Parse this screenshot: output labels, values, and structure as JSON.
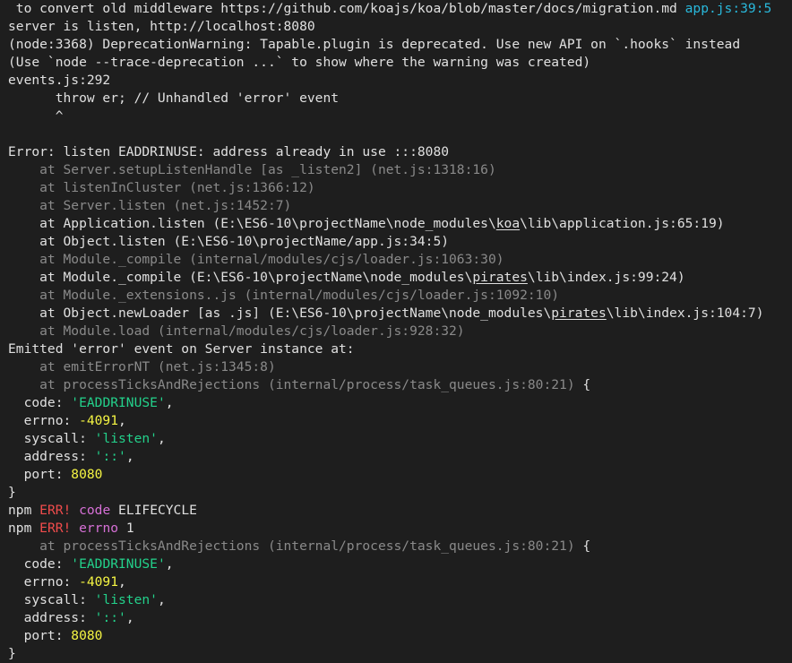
{
  "colors": {
    "background": "#1e1e1e",
    "default": "#e0e0e0",
    "gray": "#8a8a8a",
    "green": "#23d18b",
    "yellow": "#f5f543",
    "red": "#f14c4c",
    "magenta": "#d670d6",
    "cyan": "#29b8db"
  },
  "lines": [
    [
      {
        "t": " to convert old middleware https://github.com/koajs/koa/blob/master/docs/migration.md ",
        "c": "default"
      },
      {
        "t": "app.js:39:5",
        "c": "cyan"
      }
    ],
    [
      {
        "t": "server is listen, http://localhost:8080",
        "c": "default"
      }
    ],
    [
      {
        "t": "(node:3368) DeprecationWarning: Tapable.plugin is deprecated. Use new API on `.hooks` instead",
        "c": "default"
      }
    ],
    [
      {
        "t": "(Use `node --trace-deprecation ...` to show where the warning was created)",
        "c": "default"
      }
    ],
    [
      {
        "t": "events.js:292",
        "c": "default"
      }
    ],
    [
      {
        "t": "      throw er; // Unhandled 'error' event",
        "c": "default"
      }
    ],
    [
      {
        "t": "      ^",
        "c": "default"
      }
    ],
    [
      {
        "t": "",
        "c": "default"
      }
    ],
    [
      {
        "t": "Error: listen EADDRINUSE: address already in use :::8080",
        "c": "default"
      }
    ],
    [
      {
        "t": "    at Server.setupListenHandle [as _listen2] (net.js:1318:16)",
        "c": "gray"
      }
    ],
    [
      {
        "t": "    at listenInCluster (net.js:1366:12)",
        "c": "gray"
      }
    ],
    [
      {
        "t": "    at Server.listen (net.js:1452:7)",
        "c": "gray"
      }
    ],
    [
      {
        "t": "    at Application.listen (E:\\ES6-10\\projectName\\node_modules\\",
        "c": "default"
      },
      {
        "t": "koa",
        "c": "default",
        "u": true
      },
      {
        "t": "\\lib\\application.js:65:19)",
        "c": "default"
      }
    ],
    [
      {
        "t": "    at Object.listen (E:\\ES6-10\\projectName/app.js:34:5)",
        "c": "default"
      }
    ],
    [
      {
        "t": "    at Module._compile (internal/modules/cjs/loader.js:1063:30)",
        "c": "gray"
      }
    ],
    [
      {
        "t": "    at Module._compile (E:\\ES6-10\\projectName\\node_modules\\",
        "c": "default"
      },
      {
        "t": "pirates",
        "c": "default",
        "u": true
      },
      {
        "t": "\\lib\\index.js:99:24)",
        "c": "default"
      }
    ],
    [
      {
        "t": "    at Module._extensions..js (internal/modules/cjs/loader.js:1092:10)",
        "c": "gray"
      }
    ],
    [
      {
        "t": "    at Object.newLoader [as .js] (E:\\ES6-10\\projectName\\node_modules\\",
        "c": "default"
      },
      {
        "t": "pirates",
        "c": "default",
        "u": true
      },
      {
        "t": "\\lib\\index.js:104:7)",
        "c": "default"
      }
    ],
    [
      {
        "t": "    at Module.load (internal/modules/cjs/loader.js:928:32)",
        "c": "gray"
      }
    ],
    [
      {
        "t": "Emitted 'error' event on Server instance at:",
        "c": "default"
      }
    ],
    [
      {
        "t": "    at emitErrorNT (net.js:1345:8)",
        "c": "gray"
      }
    ],
    [
      {
        "t": "    at processTicksAndRejections (internal/process/task_queues.js:80:21)",
        "c": "gray"
      },
      {
        "t": " {",
        "c": "default"
      }
    ],
    [
      {
        "t": "  code: ",
        "c": "default"
      },
      {
        "t": "'EADDRINUSE'",
        "c": "green"
      },
      {
        "t": ",",
        "c": "default"
      }
    ],
    [
      {
        "t": "  errno: ",
        "c": "default"
      },
      {
        "t": "-4091",
        "c": "yellow"
      },
      {
        "t": ",",
        "c": "default"
      }
    ],
    [
      {
        "t": "  syscall: ",
        "c": "default"
      },
      {
        "t": "'listen'",
        "c": "green"
      },
      {
        "t": ",",
        "c": "default"
      }
    ],
    [
      {
        "t": "  address: ",
        "c": "default"
      },
      {
        "t": "'::'",
        "c": "green"
      },
      {
        "t": ",",
        "c": "default"
      }
    ],
    [
      {
        "t": "  port: ",
        "c": "default"
      },
      {
        "t": "8080",
        "c": "yellow"
      }
    ],
    [
      {
        "t": "}",
        "c": "default"
      }
    ],
    [
      {
        "t": "npm ",
        "c": "default"
      },
      {
        "t": "ERR!",
        "c": "red"
      },
      {
        "t": " ",
        "c": "default"
      },
      {
        "t": "code",
        "c": "magenta"
      },
      {
        "t": " ELIFECYCLE",
        "c": "default"
      }
    ],
    [
      {
        "t": "npm ",
        "c": "default"
      },
      {
        "t": "ERR!",
        "c": "red"
      },
      {
        "t": " ",
        "c": "default"
      },
      {
        "t": "errno",
        "c": "magenta"
      },
      {
        "t": " 1",
        "c": "default"
      }
    ],
    [
      {
        "t": "    at processTicksAndRejections (internal/process/task_queues.js:80:21)",
        "c": "gray"
      },
      {
        "t": " {",
        "c": "default"
      }
    ],
    [
      {
        "t": "  code: ",
        "c": "default"
      },
      {
        "t": "'EADDRINUSE'",
        "c": "green"
      },
      {
        "t": ",",
        "c": "default"
      }
    ],
    [
      {
        "t": "  errno: ",
        "c": "default"
      },
      {
        "t": "-4091",
        "c": "yellow"
      },
      {
        "t": ",",
        "c": "default"
      }
    ],
    [
      {
        "t": "  syscall: ",
        "c": "default"
      },
      {
        "t": "'listen'",
        "c": "green"
      },
      {
        "t": ",",
        "c": "default"
      }
    ],
    [
      {
        "t": "  address: ",
        "c": "default"
      },
      {
        "t": "'::'",
        "c": "green"
      },
      {
        "t": ",",
        "c": "default"
      }
    ],
    [
      {
        "t": "  port: ",
        "c": "default"
      },
      {
        "t": "8080",
        "c": "yellow"
      }
    ],
    [
      {
        "t": "}",
        "c": "default"
      }
    ]
  ]
}
